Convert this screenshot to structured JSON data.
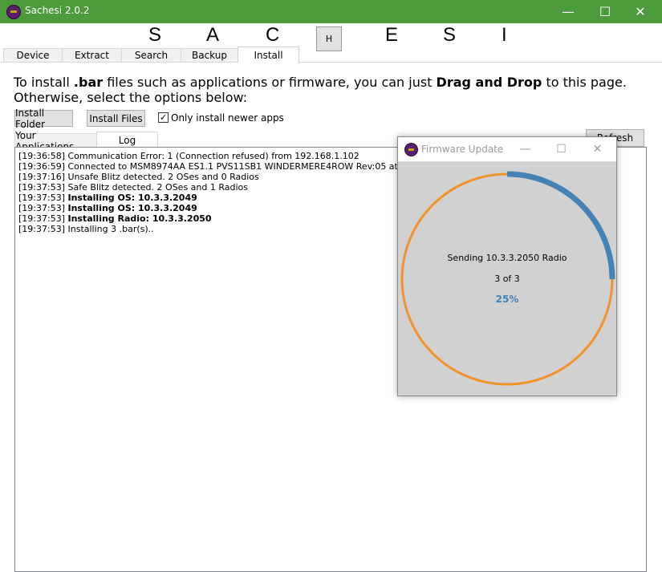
{
  "window": {
    "title": "Sachesi 2.0.2",
    "accent": "#4b9a3c",
    "controls": {
      "minimize": "—",
      "maximize": "☐",
      "close": "✕"
    }
  },
  "logo": {
    "letters": [
      "S",
      "A",
      "C",
      "H",
      "E",
      "S",
      "I"
    ]
  },
  "tabs": [
    "Device",
    "Extract",
    "Search",
    "Backup",
    "Install"
  ],
  "active_tab": "Install",
  "intro": {
    "p1": "To install ",
    "b1": ".bar",
    "p2": " files such as applications or firmware, you can just ",
    "b2": "Drag and Drop",
    "p3": " to this page. Otherwise, select the options below:"
  },
  "buttons": {
    "install_folder": "Install Folder",
    "install_files": "Install Files",
    "refresh": "Refresh"
  },
  "checkbox": {
    "label": "Only install newer apps",
    "checked": true
  },
  "subtabs": [
    "Your Applications",
    "Log"
  ],
  "active_subtab": "Log",
  "log": [
    {
      "time": "[19:36:58]",
      "text": "Communication Error: 1 (Connection refused) from 192.168.1.102",
      "bold": false
    },
    {
      "time": "[19:36:59]",
      "text": "Connected to MSM8974AA ES1.1 PVS11SB1 WINDERMERE4ROW Rev:05 at 169.254.97.",
      "bold": false
    },
    {
      "time": "[19:37:16]",
      "text": "Unsafe Blitz detected. 2 OSes and 0 Radios",
      "bold": false
    },
    {
      "time": "[19:37:53]",
      "text": "Safe Blitz detected. 2 OSes and 1 Radios",
      "bold": false
    },
    {
      "time": "[19:37:53]",
      "text": "Installing OS: 10.3.3.2049",
      "bold": true
    },
    {
      "time": "[19:37:53]",
      "text": "Installing OS: 10.3.3.2049",
      "bold": true
    },
    {
      "time": "[19:37:53]",
      "text": "Installing Radio: 10.3.3.2050",
      "bold": true
    },
    {
      "time": "[19:37:53]",
      "text": "Installing 3 .bar(s)..",
      "bold": false
    }
  ],
  "dialog": {
    "title": "Firmware Update",
    "status": "Sending 10.3.3.2050 Radio",
    "count": "3 of 3",
    "percent": "25%",
    "progress": 0.25,
    "ring_color": "#f0932a",
    "progress_color": "#4682b4"
  }
}
